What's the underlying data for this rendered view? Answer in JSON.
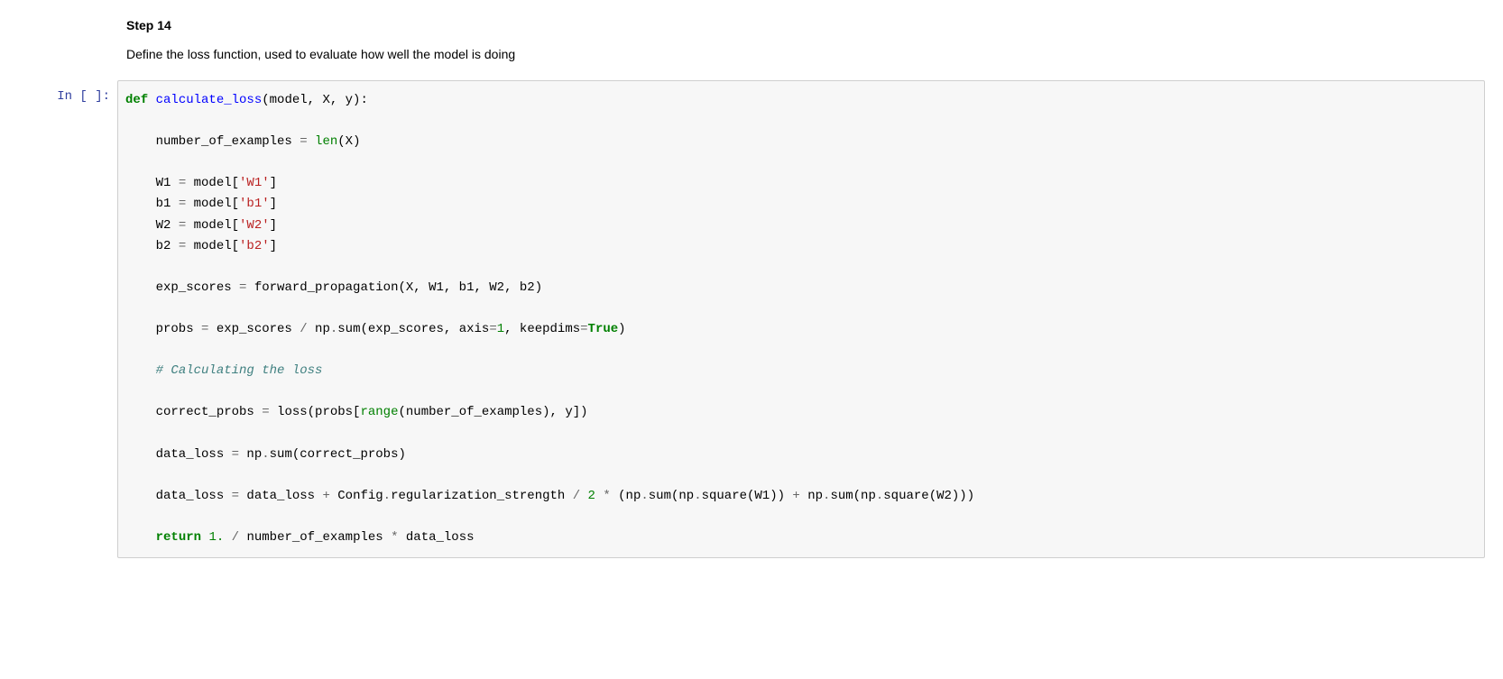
{
  "text_cell": {
    "heading": "Step 14",
    "description": "Define the loss function, used to evaluate how well the model is doing"
  },
  "code_cell": {
    "prompt": "In [ ]:",
    "tokens": [
      {
        "t": "def ",
        "c": "tok-keyword"
      },
      {
        "t": "calculate_loss",
        "c": "tok-funcname"
      },
      {
        "t": "(model, X, y):",
        "c": ""
      },
      {
        "t": "\n",
        "c": ""
      },
      {
        "t": "\n",
        "c": ""
      },
      {
        "t": "    number_of_examples ",
        "c": ""
      },
      {
        "t": "=",
        "c": "tok-operator"
      },
      {
        "t": " ",
        "c": ""
      },
      {
        "t": "len",
        "c": "tok-builtin"
      },
      {
        "t": "(X)",
        "c": ""
      },
      {
        "t": "\n",
        "c": ""
      },
      {
        "t": "\n",
        "c": ""
      },
      {
        "t": "    W1 ",
        "c": ""
      },
      {
        "t": "=",
        "c": "tok-operator"
      },
      {
        "t": " model[",
        "c": ""
      },
      {
        "t": "'W1'",
        "c": "tok-string"
      },
      {
        "t": "]",
        "c": ""
      },
      {
        "t": "\n",
        "c": ""
      },
      {
        "t": "    b1 ",
        "c": ""
      },
      {
        "t": "=",
        "c": "tok-operator"
      },
      {
        "t": " model[",
        "c": ""
      },
      {
        "t": "'b1'",
        "c": "tok-string"
      },
      {
        "t": "]",
        "c": ""
      },
      {
        "t": "\n",
        "c": ""
      },
      {
        "t": "    W2 ",
        "c": ""
      },
      {
        "t": "=",
        "c": "tok-operator"
      },
      {
        "t": " model[",
        "c": ""
      },
      {
        "t": "'W2'",
        "c": "tok-string"
      },
      {
        "t": "]",
        "c": ""
      },
      {
        "t": "\n",
        "c": ""
      },
      {
        "t": "    b2 ",
        "c": ""
      },
      {
        "t": "=",
        "c": "tok-operator"
      },
      {
        "t": " model[",
        "c": ""
      },
      {
        "t": "'b2'",
        "c": "tok-string"
      },
      {
        "t": "]",
        "c": ""
      },
      {
        "t": "\n",
        "c": ""
      },
      {
        "t": "\n",
        "c": ""
      },
      {
        "t": "    exp_scores ",
        "c": ""
      },
      {
        "t": "=",
        "c": "tok-operator"
      },
      {
        "t": " forward_propagation(X, W1, b1, W2, b2)",
        "c": ""
      },
      {
        "t": "\n",
        "c": ""
      },
      {
        "t": "\n",
        "c": ""
      },
      {
        "t": "    probs ",
        "c": ""
      },
      {
        "t": "=",
        "c": "tok-operator"
      },
      {
        "t": " exp_scores ",
        "c": ""
      },
      {
        "t": "/",
        "c": "tok-operator"
      },
      {
        "t": " np",
        "c": ""
      },
      {
        "t": ".",
        "c": "tok-operator"
      },
      {
        "t": "sum(exp_scores, axis",
        "c": ""
      },
      {
        "t": "=",
        "c": "tok-operator"
      },
      {
        "t": "1",
        "c": "tok-number"
      },
      {
        "t": ", keepdims",
        "c": ""
      },
      {
        "t": "=",
        "c": "tok-operator"
      },
      {
        "t": "True",
        "c": "tok-bool"
      },
      {
        "t": ")",
        "c": ""
      },
      {
        "t": "\n",
        "c": ""
      },
      {
        "t": "\n",
        "c": ""
      },
      {
        "t": "    ",
        "c": ""
      },
      {
        "t": "# Calculating the loss",
        "c": "tok-comment"
      },
      {
        "t": "\n",
        "c": ""
      },
      {
        "t": "\n",
        "c": ""
      },
      {
        "t": "    correct_probs ",
        "c": ""
      },
      {
        "t": "=",
        "c": "tok-operator"
      },
      {
        "t": " loss(probs[",
        "c": ""
      },
      {
        "t": "range",
        "c": "tok-builtin"
      },
      {
        "t": "(number_of_examples), y])",
        "c": ""
      },
      {
        "t": "\n",
        "c": ""
      },
      {
        "t": "\n",
        "c": ""
      },
      {
        "t": "    data_loss ",
        "c": ""
      },
      {
        "t": "=",
        "c": "tok-operator"
      },
      {
        "t": " np",
        "c": ""
      },
      {
        "t": ".",
        "c": "tok-operator"
      },
      {
        "t": "sum(correct_probs)",
        "c": ""
      },
      {
        "t": "\n",
        "c": ""
      },
      {
        "t": "\n",
        "c": ""
      },
      {
        "t": "    data_loss ",
        "c": ""
      },
      {
        "t": "=",
        "c": "tok-operator"
      },
      {
        "t": " data_loss ",
        "c": ""
      },
      {
        "t": "+",
        "c": "tok-operator"
      },
      {
        "t": " Config",
        "c": ""
      },
      {
        "t": ".",
        "c": "tok-operator"
      },
      {
        "t": "regularization_strength ",
        "c": ""
      },
      {
        "t": "/",
        "c": "tok-operator"
      },
      {
        "t": " ",
        "c": ""
      },
      {
        "t": "2",
        "c": "tok-number"
      },
      {
        "t": " ",
        "c": ""
      },
      {
        "t": "*",
        "c": "tok-operator"
      },
      {
        "t": " (np",
        "c": ""
      },
      {
        "t": ".",
        "c": "tok-operator"
      },
      {
        "t": "sum(np",
        "c": ""
      },
      {
        "t": ".",
        "c": "tok-operator"
      },
      {
        "t": "square(W1)) ",
        "c": ""
      },
      {
        "t": "+",
        "c": "tok-operator"
      },
      {
        "t": " np",
        "c": ""
      },
      {
        "t": ".",
        "c": "tok-operator"
      },
      {
        "t": "sum(np",
        "c": ""
      },
      {
        "t": ".",
        "c": "tok-operator"
      },
      {
        "t": "square(W2)))",
        "c": ""
      },
      {
        "t": "\n",
        "c": ""
      },
      {
        "t": "\n",
        "c": ""
      },
      {
        "t": "    ",
        "c": ""
      },
      {
        "t": "return",
        "c": "tok-keyword"
      },
      {
        "t": " ",
        "c": ""
      },
      {
        "t": "1.",
        "c": "tok-number"
      },
      {
        "t": " ",
        "c": ""
      },
      {
        "t": "/",
        "c": "tok-operator"
      },
      {
        "t": " number_of_examples ",
        "c": ""
      },
      {
        "t": "*",
        "c": "tok-operator"
      },
      {
        "t": " data_loss",
        "c": ""
      }
    ]
  }
}
